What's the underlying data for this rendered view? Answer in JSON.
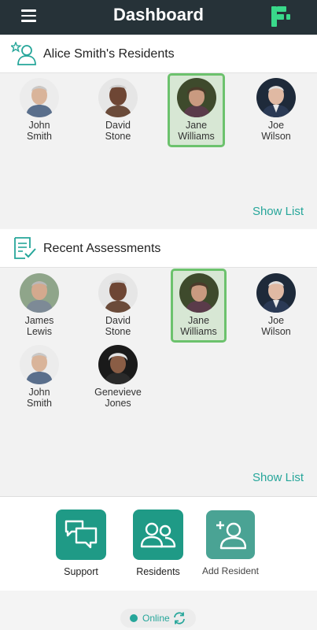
{
  "header": {
    "title": "Dashboard"
  },
  "residents_section": {
    "title": "Alice Smith's Residents",
    "show_list": "Show List",
    "items": [
      {
        "first": "John",
        "last": "Smith",
        "selected": false
      },
      {
        "first": "David",
        "last": "Stone",
        "selected": false
      },
      {
        "first": "Jane",
        "last": "Williams",
        "selected": true
      },
      {
        "first": "Joe",
        "last": "Wilson",
        "selected": false
      }
    ]
  },
  "assessments_section": {
    "title": "Recent Assessments",
    "show_list": "Show List",
    "items": [
      {
        "first": "James",
        "last": "Lewis",
        "selected": false
      },
      {
        "first": "David",
        "last": "Stone",
        "selected": false
      },
      {
        "first": "Jane",
        "last": "Williams",
        "selected": true
      },
      {
        "first": "Joe",
        "last": "Wilson",
        "selected": false
      },
      {
        "first": "John",
        "last": "Smith",
        "selected": false
      },
      {
        "first": "Genevieve",
        "last": "Jones",
        "selected": false
      }
    ]
  },
  "actions": {
    "support": "Support",
    "residents": "Residents",
    "add_resident": "Add Resident"
  },
  "status": {
    "text": "Online"
  },
  "colors": {
    "accent": "#26a69a",
    "topbar": "#263238",
    "highlight_border": "#6cc26d",
    "highlight_fill": "#d7e7d4"
  }
}
